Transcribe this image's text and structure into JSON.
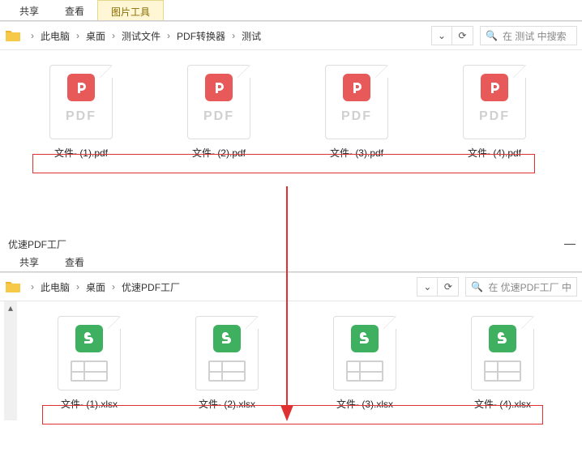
{
  "colors": {
    "pdf_badge": "#e85a5a",
    "xlsx_badge": "#3fb060",
    "redbox": "#e03030"
  },
  "top": {
    "tabs": {
      "share": "共享",
      "view": "查看",
      "pictools": "图片工具"
    },
    "breadcrumb": {
      "pc": "此电脑",
      "desktop": "桌面",
      "f1": "测试文件",
      "f2": "PDF转换器",
      "f3": "测试"
    },
    "search": {
      "icon": "🔍",
      "placeholder": "在 测试 中搜索"
    },
    "refresh_icon": "⟳",
    "dropdown_icon": "⌄",
    "files": [
      {
        "name": "文件- (1).pdf"
      },
      {
        "name": "文件- (2).pdf"
      },
      {
        "name": "文件- (3).pdf"
      },
      {
        "name": "文件- (4).pdf"
      }
    ],
    "pdf_label": "PDF"
  },
  "bottom": {
    "title": "优速PDF工厂",
    "tabs": {
      "share": "共享",
      "view": "查看"
    },
    "breadcrumb": {
      "pc": "此电脑",
      "desktop": "桌面",
      "f1": "优速PDF工厂"
    },
    "search": {
      "icon": "🔍",
      "placeholder": "在 优速PDF工厂 中"
    },
    "refresh_icon": "⟳",
    "dropdown_icon": "⌄",
    "files": [
      {
        "name": "文件- (1).xlsx"
      },
      {
        "name": "文件- (2).xlsx"
      },
      {
        "name": "文件- (3).xlsx"
      },
      {
        "name": "文件- (4).xlsx"
      }
    ]
  }
}
